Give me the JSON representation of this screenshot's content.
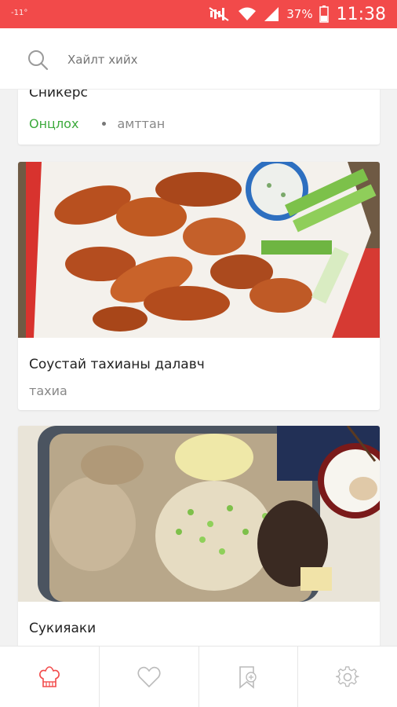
{
  "status_bar": {
    "left_text": "-11°",
    "battery_percent": "37%",
    "time": "11:38",
    "background_color": "#f24a4a",
    "icons": [
      "mute-icon",
      "wifi-icon",
      "signal-icon",
      "battery-icon"
    ]
  },
  "search": {
    "placeholder": "Хайлт хийх",
    "icon": "search-icon"
  },
  "cards": [
    {
      "title": "Сникерс",
      "tag": "Онцлох",
      "category": "амттан",
      "tag_color": "#3caa3c"
    },
    {
      "title": "Соустай тахианы далавч",
      "category": "тахиа",
      "image": "chicken-wings-photo"
    },
    {
      "title": "Сукияаки",
      "image": "sukiyaki-photo"
    }
  ],
  "bottom_nav": {
    "items": [
      {
        "icon": "chef-hat-icon",
        "active": true
      },
      {
        "icon": "heart-icon",
        "active": false
      },
      {
        "icon": "bookmark-add-icon",
        "active": false
      },
      {
        "icon": "gear-icon",
        "active": false
      }
    ],
    "active_color": "#f24a4a",
    "inactive_color": "#bbbbbb"
  }
}
